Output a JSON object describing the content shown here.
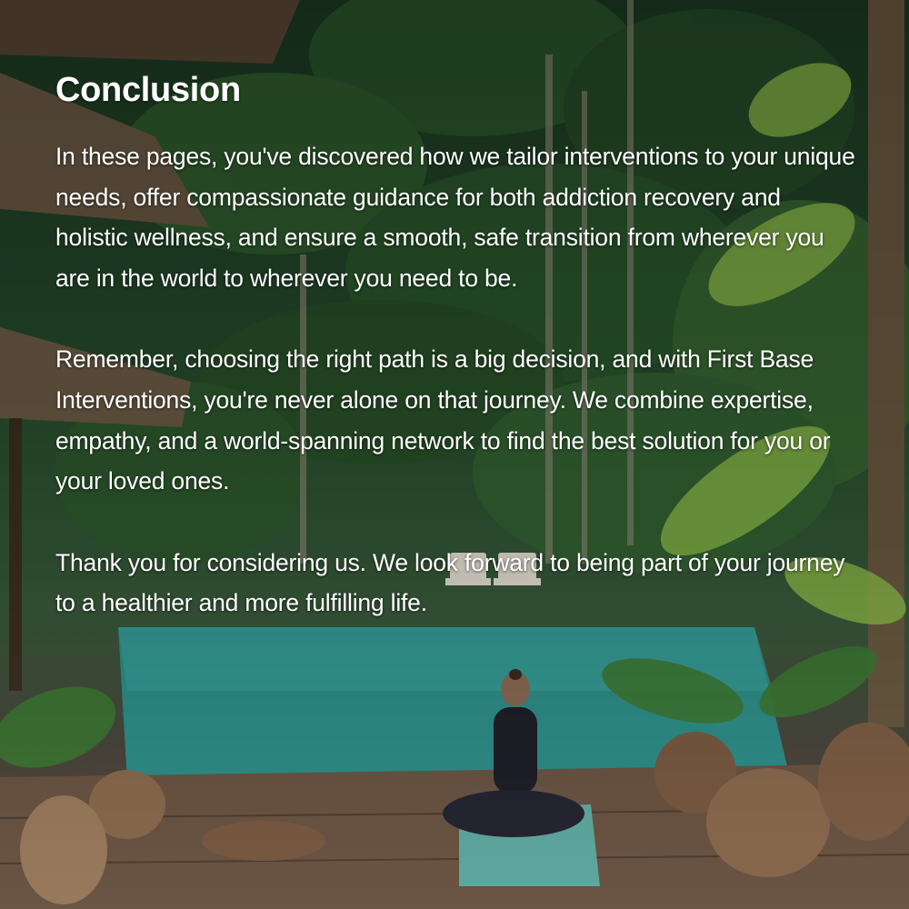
{
  "slide": {
    "title": "Conclusion",
    "paragraphs": [
      "In these pages, you've discovered how we tailor interventions to your unique needs, offer compassionate guidance for both addiction recovery and holistic wellness, and ensure a smooth, safe transition from wherever you are in the world to wherever you need to be.",
      "Remember, choosing the right path is a big decision, and with First Base Interventions, you're never alone on that journey. We combine expertise, empathy, and a world-spanning network to find the best solution for you or your loved ones.",
      "Thank you for considering us. We look forward to being part of your journey to a healthier and more fulfilling life."
    ]
  },
  "colors": {
    "text": "#ffffff",
    "foliage": "#2f5634",
    "pool": "#2f8f8a",
    "deck": "#5a4a3c"
  }
}
